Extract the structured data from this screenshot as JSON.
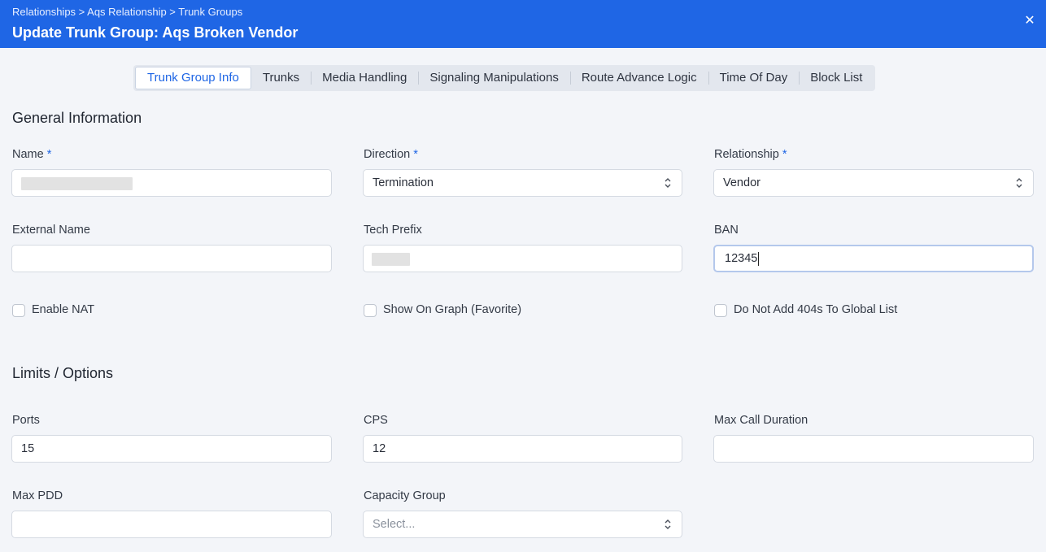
{
  "header": {
    "breadcrumb": "Relationships > Aqs Relationship > Trunk Groups",
    "title": "Update Trunk Group: Aqs Broken Vendor",
    "close_glyph": "✕"
  },
  "tabs": [
    {
      "label": "Trunk Group Info",
      "active": true
    },
    {
      "label": "Trunks"
    },
    {
      "label": "Media Handling"
    },
    {
      "label": "Signaling Manipulations"
    },
    {
      "label": "Route Advance Logic"
    },
    {
      "label": "Time Of Day"
    },
    {
      "label": "Block List"
    }
  ],
  "general": {
    "title": "General Information",
    "name": {
      "label": "Name",
      "required_mark": "*",
      "value": ""
    },
    "direction": {
      "label": "Direction",
      "required_mark": "*",
      "value": "Termination"
    },
    "relationship": {
      "label": "Relationship",
      "required_mark": "*",
      "value": "Vendor"
    },
    "external_name": {
      "label": "External Name",
      "value": ""
    },
    "tech_prefix": {
      "label": "Tech Prefix",
      "value": ""
    },
    "ban": {
      "label": "BAN",
      "value": "12345"
    },
    "enable_nat": {
      "label": "Enable NAT",
      "checked": false
    },
    "show_on_graph": {
      "label": "Show On Graph (Favorite)",
      "checked": false
    },
    "do_not_add_404s": {
      "label": "Do Not Add 404s To Global List",
      "checked": false
    }
  },
  "limits": {
    "title": "Limits / Options",
    "ports": {
      "label": "Ports",
      "value": "15"
    },
    "cps": {
      "label": "CPS",
      "value": "12"
    },
    "max_call_duration": {
      "label": "Max Call Duration",
      "value": ""
    },
    "max_pdd": {
      "label": "Max PDD",
      "value": ""
    },
    "capacity_group": {
      "label": "Capacity Group",
      "placeholder": "Select..."
    }
  },
  "colors": {
    "header_bg": "#1f66e5",
    "accent": "#1f66e5",
    "page_bg": "#f3f5f9"
  }
}
